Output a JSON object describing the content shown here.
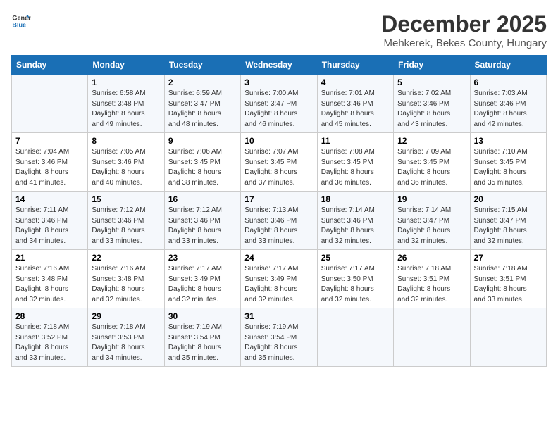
{
  "logo": {
    "line1": "General",
    "line2": "Blue"
  },
  "title": "December 2025",
  "location": "Mehkerek, Bekes County, Hungary",
  "days_of_week": [
    "Sunday",
    "Monday",
    "Tuesday",
    "Wednesday",
    "Thursday",
    "Friday",
    "Saturday"
  ],
  "weeks": [
    [
      {
        "day": "",
        "info": ""
      },
      {
        "day": "1",
        "info": "Sunrise: 6:58 AM\nSunset: 3:48 PM\nDaylight: 8 hours\nand 49 minutes."
      },
      {
        "day": "2",
        "info": "Sunrise: 6:59 AM\nSunset: 3:47 PM\nDaylight: 8 hours\nand 48 minutes."
      },
      {
        "day": "3",
        "info": "Sunrise: 7:00 AM\nSunset: 3:47 PM\nDaylight: 8 hours\nand 46 minutes."
      },
      {
        "day": "4",
        "info": "Sunrise: 7:01 AM\nSunset: 3:46 PM\nDaylight: 8 hours\nand 45 minutes."
      },
      {
        "day": "5",
        "info": "Sunrise: 7:02 AM\nSunset: 3:46 PM\nDaylight: 8 hours\nand 43 minutes."
      },
      {
        "day": "6",
        "info": "Sunrise: 7:03 AM\nSunset: 3:46 PM\nDaylight: 8 hours\nand 42 minutes."
      }
    ],
    [
      {
        "day": "7",
        "info": "Sunrise: 7:04 AM\nSunset: 3:46 PM\nDaylight: 8 hours\nand 41 minutes."
      },
      {
        "day": "8",
        "info": "Sunrise: 7:05 AM\nSunset: 3:46 PM\nDaylight: 8 hours\nand 40 minutes."
      },
      {
        "day": "9",
        "info": "Sunrise: 7:06 AM\nSunset: 3:45 PM\nDaylight: 8 hours\nand 38 minutes."
      },
      {
        "day": "10",
        "info": "Sunrise: 7:07 AM\nSunset: 3:45 PM\nDaylight: 8 hours\nand 37 minutes."
      },
      {
        "day": "11",
        "info": "Sunrise: 7:08 AM\nSunset: 3:45 PM\nDaylight: 8 hours\nand 36 minutes."
      },
      {
        "day": "12",
        "info": "Sunrise: 7:09 AM\nSunset: 3:45 PM\nDaylight: 8 hours\nand 36 minutes."
      },
      {
        "day": "13",
        "info": "Sunrise: 7:10 AM\nSunset: 3:45 PM\nDaylight: 8 hours\nand 35 minutes."
      }
    ],
    [
      {
        "day": "14",
        "info": "Sunrise: 7:11 AM\nSunset: 3:46 PM\nDaylight: 8 hours\nand 34 minutes."
      },
      {
        "day": "15",
        "info": "Sunrise: 7:12 AM\nSunset: 3:46 PM\nDaylight: 8 hours\nand 33 minutes."
      },
      {
        "day": "16",
        "info": "Sunrise: 7:12 AM\nSunset: 3:46 PM\nDaylight: 8 hours\nand 33 minutes."
      },
      {
        "day": "17",
        "info": "Sunrise: 7:13 AM\nSunset: 3:46 PM\nDaylight: 8 hours\nand 33 minutes."
      },
      {
        "day": "18",
        "info": "Sunrise: 7:14 AM\nSunset: 3:46 PM\nDaylight: 8 hours\nand 32 minutes."
      },
      {
        "day": "19",
        "info": "Sunrise: 7:14 AM\nSunset: 3:47 PM\nDaylight: 8 hours\nand 32 minutes."
      },
      {
        "day": "20",
        "info": "Sunrise: 7:15 AM\nSunset: 3:47 PM\nDaylight: 8 hours\nand 32 minutes."
      }
    ],
    [
      {
        "day": "21",
        "info": "Sunrise: 7:16 AM\nSunset: 3:48 PM\nDaylight: 8 hours\nand 32 minutes."
      },
      {
        "day": "22",
        "info": "Sunrise: 7:16 AM\nSunset: 3:48 PM\nDaylight: 8 hours\nand 32 minutes."
      },
      {
        "day": "23",
        "info": "Sunrise: 7:17 AM\nSunset: 3:49 PM\nDaylight: 8 hours\nand 32 minutes."
      },
      {
        "day": "24",
        "info": "Sunrise: 7:17 AM\nSunset: 3:49 PM\nDaylight: 8 hours\nand 32 minutes."
      },
      {
        "day": "25",
        "info": "Sunrise: 7:17 AM\nSunset: 3:50 PM\nDaylight: 8 hours\nand 32 minutes."
      },
      {
        "day": "26",
        "info": "Sunrise: 7:18 AM\nSunset: 3:51 PM\nDaylight: 8 hours\nand 32 minutes."
      },
      {
        "day": "27",
        "info": "Sunrise: 7:18 AM\nSunset: 3:51 PM\nDaylight: 8 hours\nand 33 minutes."
      }
    ],
    [
      {
        "day": "28",
        "info": "Sunrise: 7:18 AM\nSunset: 3:52 PM\nDaylight: 8 hours\nand 33 minutes."
      },
      {
        "day": "29",
        "info": "Sunrise: 7:18 AM\nSunset: 3:53 PM\nDaylight: 8 hours\nand 34 minutes."
      },
      {
        "day": "30",
        "info": "Sunrise: 7:19 AM\nSunset: 3:54 PM\nDaylight: 8 hours\nand 35 minutes."
      },
      {
        "day": "31",
        "info": "Sunrise: 7:19 AM\nSunset: 3:54 PM\nDaylight: 8 hours\nand 35 minutes."
      },
      {
        "day": "",
        "info": ""
      },
      {
        "day": "",
        "info": ""
      },
      {
        "day": "",
        "info": ""
      }
    ]
  ]
}
